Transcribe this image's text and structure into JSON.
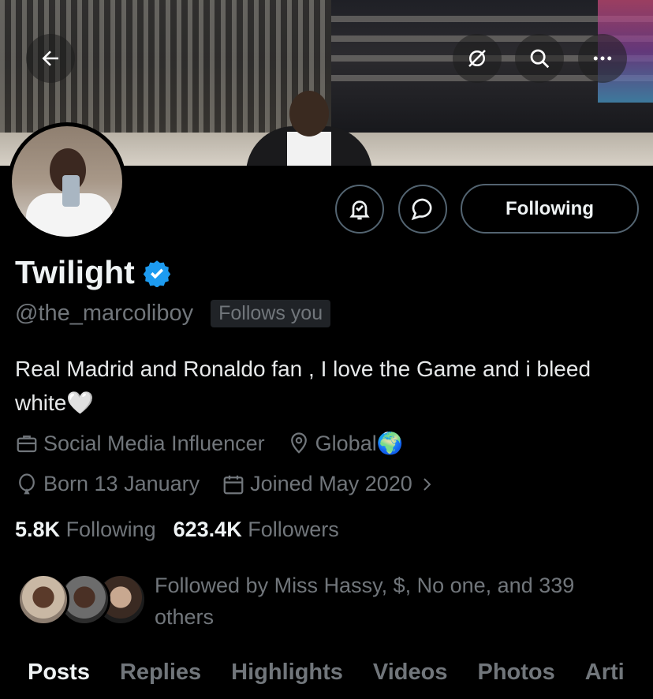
{
  "header": {
    "back_icon": "arrow-left-icon",
    "actions": [
      "unlink-icon",
      "search-icon",
      "more-icon"
    ]
  },
  "profile": {
    "name": "Twilight",
    "verified": true,
    "verified_color": "#1d9bf0",
    "handle": "@the_marcoliboy",
    "follows_you": "Follows you",
    "bio": "Real Madrid and Ronaldo fan , I love the Game and i bleed white🤍",
    "category": "Social Media Influencer",
    "location": "Global🌍",
    "born": "Born 13 January",
    "joined": "Joined May 2020",
    "following_count": "5.8K",
    "following_label": "Following",
    "followers_count": "623.4K",
    "followers_label": "Followers",
    "followed_by": "Followed by Miss Hassy, $, No one, and 339 others"
  },
  "buttons": {
    "notify_icon": "bell-check-icon",
    "message_icon": "message-bubble-icon",
    "following_label": "Following"
  },
  "tabs": [
    {
      "label": "Posts",
      "active": true
    },
    {
      "label": "Replies",
      "active": false
    },
    {
      "label": "Highlights",
      "active": false
    },
    {
      "label": "Videos",
      "active": false
    },
    {
      "label": "Photos",
      "active": false
    },
    {
      "label": "Arti",
      "active": false
    }
  ],
  "colors": {
    "background": "#000000",
    "text_primary": "#eff3f4",
    "text_secondary": "#71767b",
    "border": "#536471"
  }
}
